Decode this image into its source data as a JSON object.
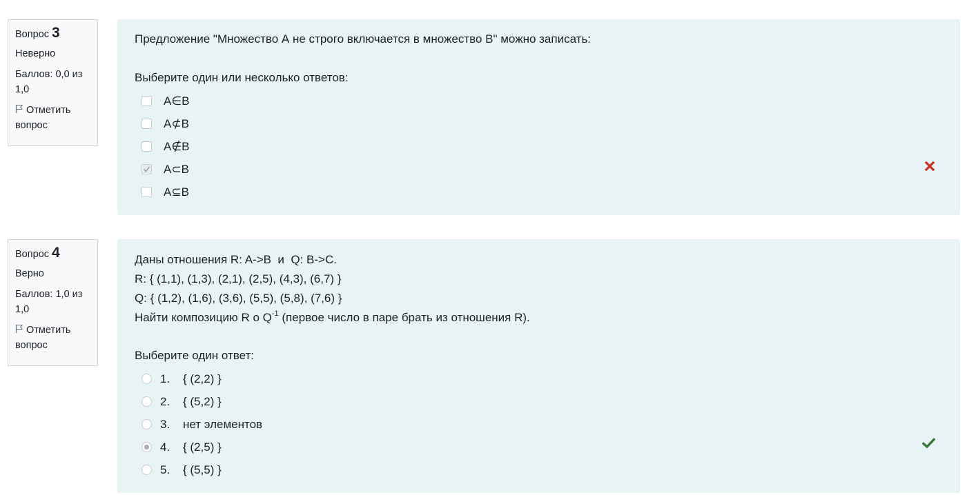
{
  "q3": {
    "label": "Вопрос",
    "number": "3",
    "state": "Неверно",
    "grade": "Баллов: 0,0 из 1,0",
    "flag": "Отметить вопрос",
    "text": "Предложение \"Множество А не строго включается в множество В\" можно записать:",
    "prompt": "Выберите один или несколько ответов:",
    "options": [
      "A∈B",
      "A⊄B",
      "A∉B",
      "A⊂B",
      "A⊆B"
    ],
    "checked_index": 3,
    "result_mark": "✖",
    "result_color": "#ca3120"
  },
  "q4": {
    "label": "Вопрос",
    "number": "4",
    "state": "Верно",
    "grade": "Баллов: 1,0 из 1,0",
    "flag": "Отметить вопрос",
    "line1": "Даны отношения R: A->B  и  Q: B->C.",
    "line2": "R: { (1,1), (1,3), (2,1), (2,5), (4,3), (6,7) }",
    "line3": "Q: { (1,2), (1,6), (3,6), (5,5), (5,8), (7,6) }",
    "line4_before": "Найти композицию R o Q",
    "line4_sup": "-1",
    "line4_after": " (первое число в паре брать из отношения R).",
    "prompt": "Выберите один ответ:",
    "options": [
      {
        "num": "1.",
        "text": "{ (2,2) }"
      },
      {
        "num": "2.",
        "text": "{ (5,2) }"
      },
      {
        "num": "3.",
        "text": "нет элементов"
      },
      {
        "num": "4.",
        "text": "{ (2,5) }"
      },
      {
        "num": "5.",
        "text": "{ (5,5) }"
      }
    ],
    "selected_index": 3,
    "result_mark": "✔",
    "result_color": "#357a32"
  }
}
